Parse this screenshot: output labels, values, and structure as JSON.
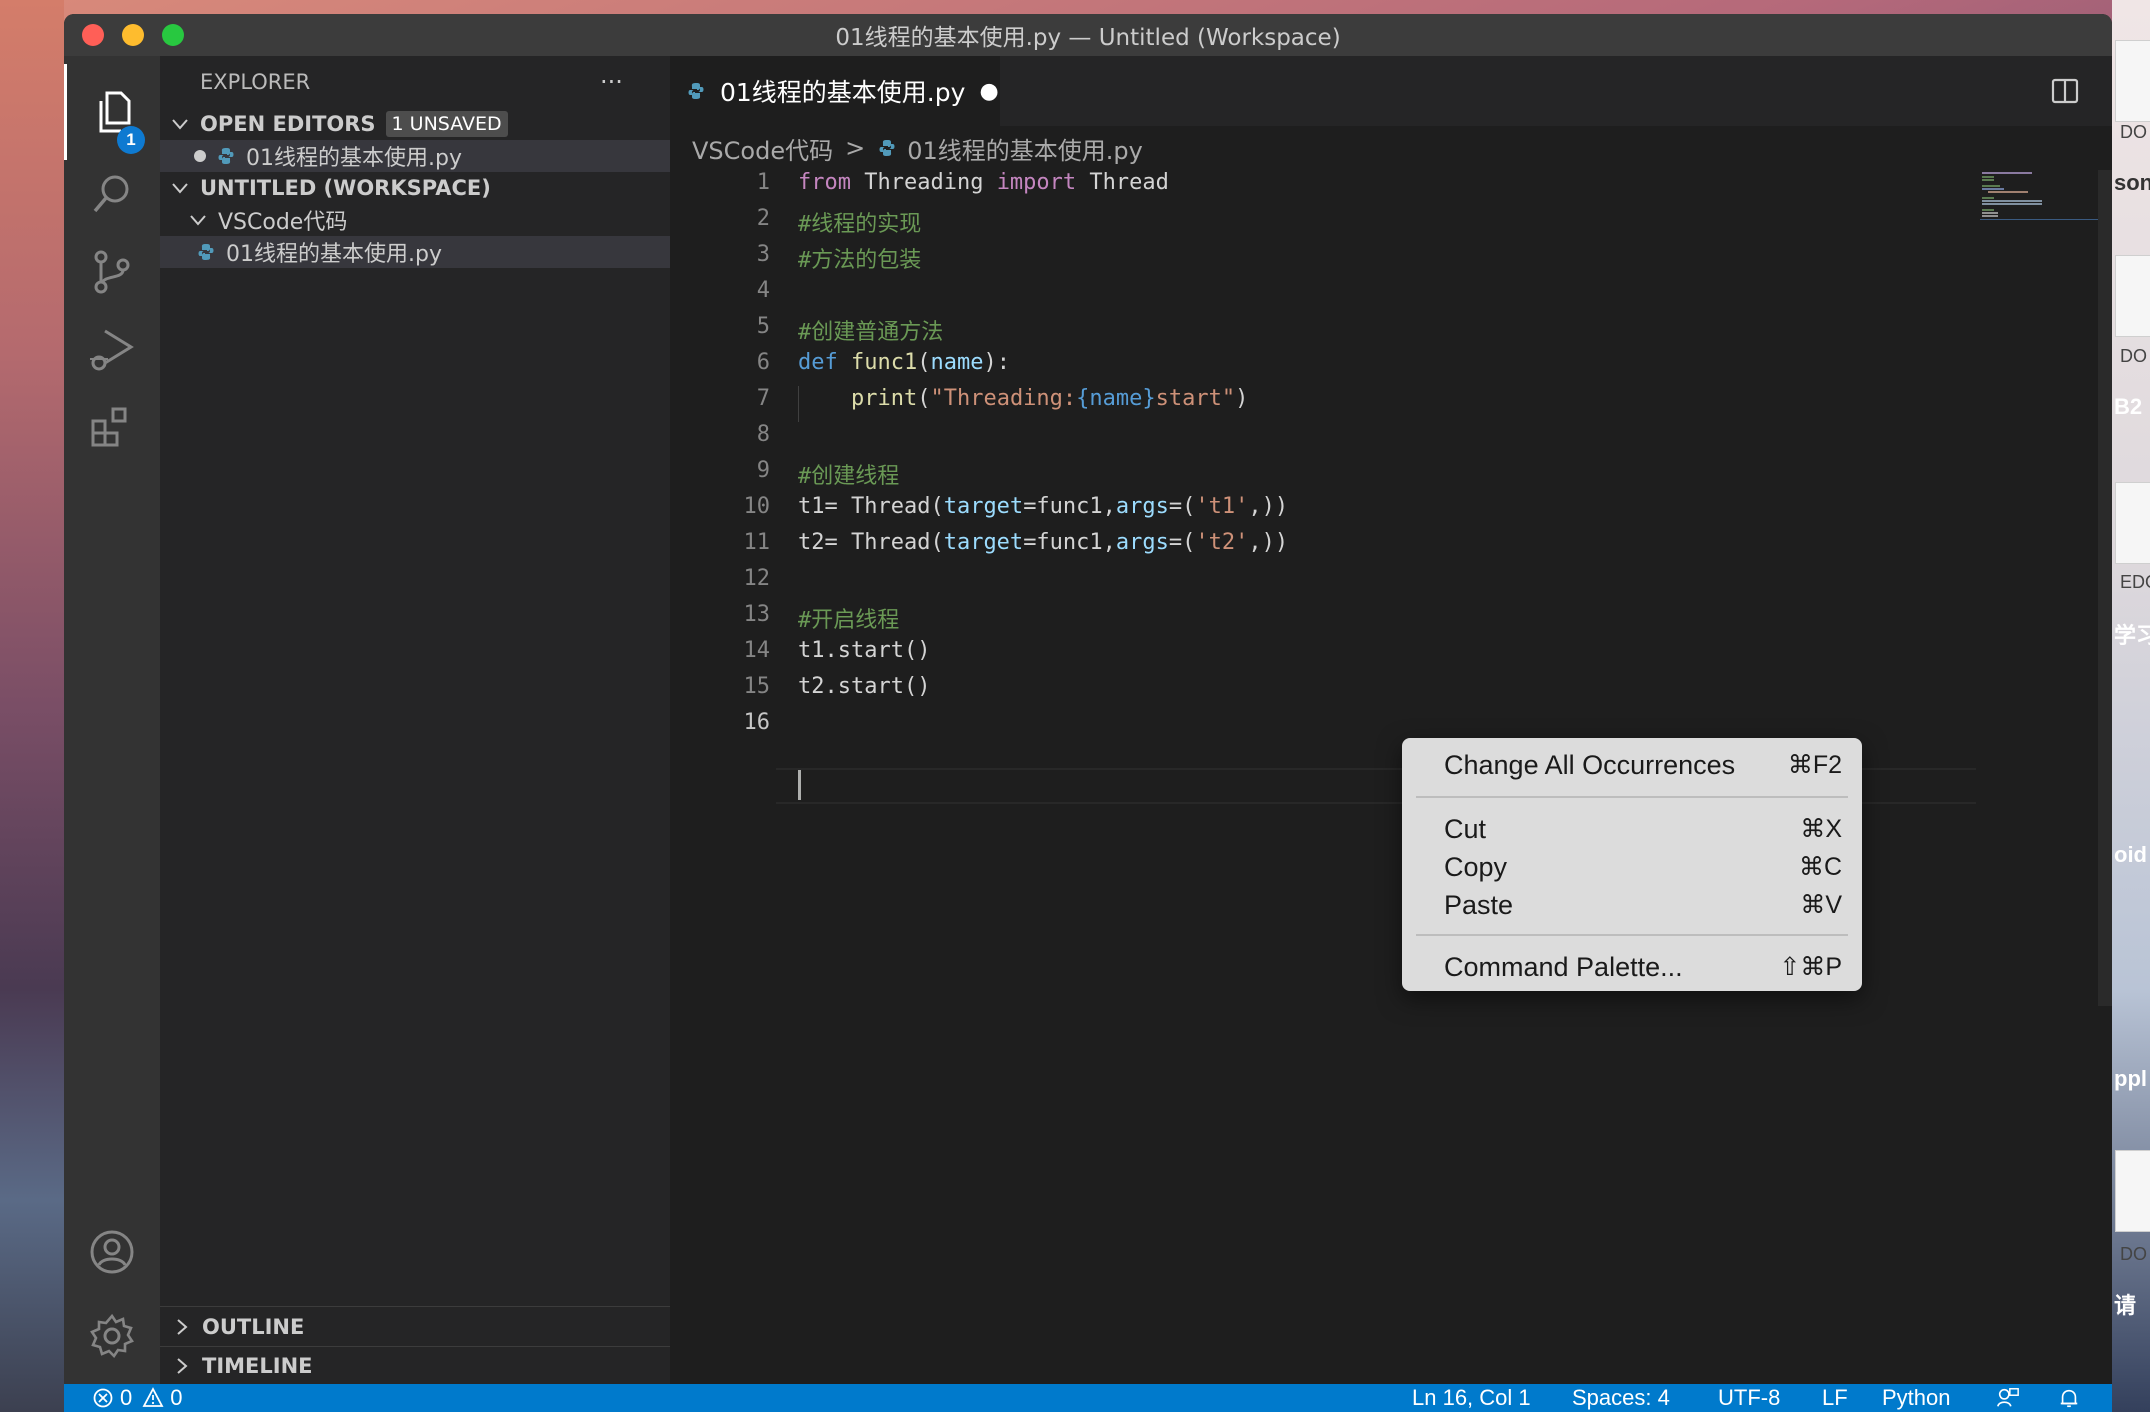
{
  "window": {
    "title": "01线程的基本使用.py — Untitled (Workspace)",
    "traffic_lights": [
      "#ff5f57",
      "#febc2e",
      "#28c840"
    ]
  },
  "activity_bar": {
    "explorer_badge": "1",
    "icons": [
      "explorer-icon",
      "search-icon",
      "source-control-icon",
      "run-debug-icon",
      "extensions-icon",
      "account-icon",
      "settings-gear-icon"
    ]
  },
  "sidebar": {
    "title": "EXPLORER",
    "more_actions": "···",
    "open_editors": {
      "label": "OPEN EDITORS",
      "badge": "1 UNSAVED",
      "files": [
        {
          "name": "01线程的基本使用.py",
          "dirty": true
        }
      ]
    },
    "workspace": {
      "label": "UNTITLED (WORKSPACE)",
      "folder": "VSCode代码",
      "files": [
        "01线程的基本使用.py"
      ]
    },
    "outline_label": "OUTLINE",
    "timeline_label": "TIMELINE"
  },
  "editor": {
    "tab": {
      "name": "01线程的基本使用.py",
      "dirty_mark": "●"
    },
    "breadcrumb": {
      "folder": "VSCode代码",
      "separator": ">",
      "file": "01线程的基本使用.py"
    },
    "line_numbers": [
      "1",
      "2",
      "3",
      "4",
      "5",
      "6",
      "7",
      "8",
      "9",
      "10",
      "11",
      "12",
      "13",
      "14",
      "15",
      "16"
    ],
    "code": {
      "l1": {
        "a": "from",
        "b": " Threading ",
        "c": "import",
        "d": " Thread"
      },
      "l2": "#线程的实现",
      "l3": "#方法的包装",
      "l5": "#创建普通方法",
      "l6": {
        "a": "def",
        "b": " ",
        "c": "func1",
        "d": "(",
        "e": "name",
        "f": "):"
      },
      "l7": {
        "a": "    ",
        "b": "print",
        "c": "(",
        "d": "\"Threading:",
        "e": "{name}",
        "f": "start\"",
        "g": ")"
      },
      "l9": "#创建线程",
      "l10": {
        "a": "t1= Thread(",
        "b": "target",
        "c": "=func1,",
        "d": "args",
        "e": "=(",
        "f": "'t1'",
        "g": ",))"
      },
      "l11": {
        "a": "t2= Thread(",
        "b": "target",
        "c": "=func1,",
        "d": "args",
        "e": "=(",
        "f": "'t2'",
        "g": ",))"
      },
      "l13": "#开启线程",
      "l14": "t1.start()",
      "l15": "t2.start()"
    },
    "colors": {
      "keyword": "#c586c0",
      "def": "#569cd6",
      "function": "#dcdcaa",
      "comment": "#6a9955",
      "string": "#ce9178",
      "param": "#9cdcfe"
    }
  },
  "context_menu": {
    "items": [
      {
        "label": "Change All Occurrences",
        "shortcut": "⌘F2"
      },
      {
        "label": "Cut",
        "shortcut": "⌘X"
      },
      {
        "label": "Copy",
        "shortcut": "⌘C"
      },
      {
        "label": "Paste",
        "shortcut": "⌘V"
      },
      {
        "label": "Command Palette...",
        "shortcut": "⇧⌘P"
      }
    ]
  },
  "status_bar": {
    "errors": "0",
    "warnings": "0",
    "position": "Ln 16, Col 1",
    "spaces": "Spaces: 4",
    "encoding": "UTF-8",
    "eol": "LF",
    "language": "Python",
    "accent": "#007acc"
  },
  "desktop_right": {
    "labels": [
      "son",
      "B2",
      "学习",
      "oid",
      "ppl",
      "请"
    ],
    "small": [
      "DO",
      "DO",
      "EDO",
      "DO"
    ]
  }
}
